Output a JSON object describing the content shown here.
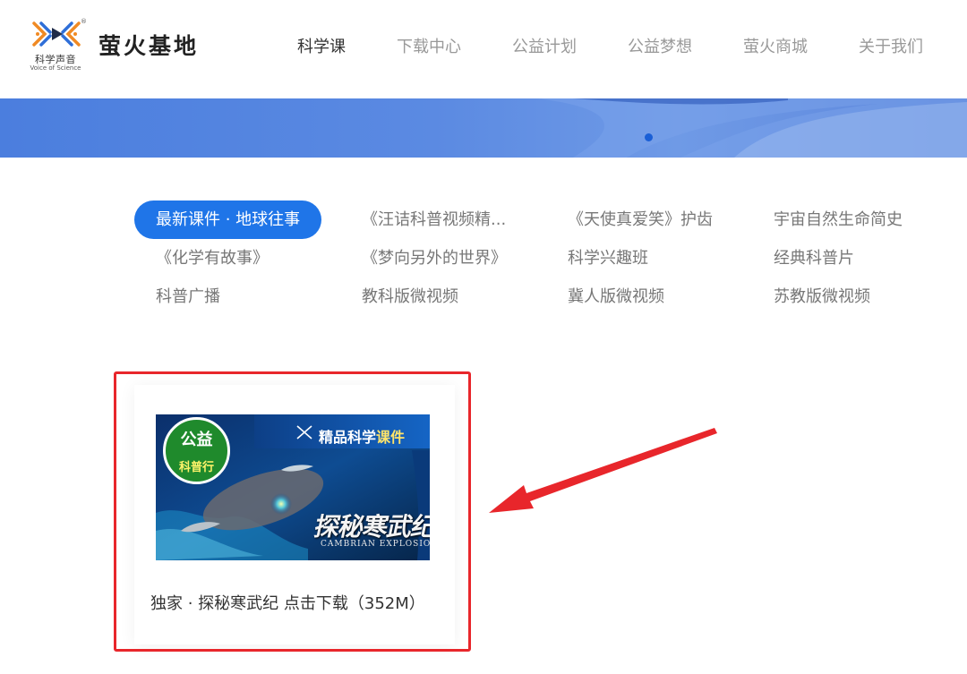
{
  "logo": {
    "name": "科学声音",
    "en": "Voice of Science",
    "reg": "®"
  },
  "site": {
    "title": "萤火基地"
  },
  "nav": {
    "items": [
      {
        "label": "科学课",
        "active": true
      },
      {
        "label": "下载中心",
        "active": false
      },
      {
        "label": "公益计划",
        "active": false
      },
      {
        "label": "公益梦想",
        "active": false
      },
      {
        "label": "萤火商城",
        "active": false
      },
      {
        "label": "关于我们",
        "active": false
      }
    ]
  },
  "categories": [
    {
      "label": "最新课件 · 地球往事",
      "active": true
    },
    {
      "label": "《汪诘科普视频精...",
      "active": false
    },
    {
      "label": "《天使真爱笑》护齿",
      "active": false
    },
    {
      "label": "宇宙自然生命简史",
      "active": false
    },
    {
      "label": "《化学有故事》",
      "active": false
    },
    {
      "label": "《梦向另外的世界》",
      "active": false
    },
    {
      "label": "科学兴趣班",
      "active": false
    },
    {
      "label": "经典科普片",
      "active": false
    },
    {
      "label": "科普广播",
      "active": false
    },
    {
      "label": "教科版微视频",
      "active": false
    },
    {
      "label": "冀人版微视频",
      "active": false
    },
    {
      "label": "苏教版微视频",
      "active": false
    }
  ],
  "card": {
    "badge_top": "公益",
    "badge_bottom": "科普行",
    "header_plain": "精品科学",
    "header_highlight": "课件",
    "title_art": "探秘寒武纪",
    "subtitle_en": "CAMBRIAN EXPLOSION",
    "caption": "独家 · 探秘寒武纪 点击下载（352M）"
  },
  "colors": {
    "accent": "#1f75e8",
    "highlight_border": "#e8262b",
    "arrow": "#e8262b",
    "banner": "#5b8ae2"
  },
  "icons": {
    "logo": "dna-play-logo-icon",
    "carousel": "carousel-dot-icon",
    "arrow": "red-pointer-arrow-icon"
  }
}
